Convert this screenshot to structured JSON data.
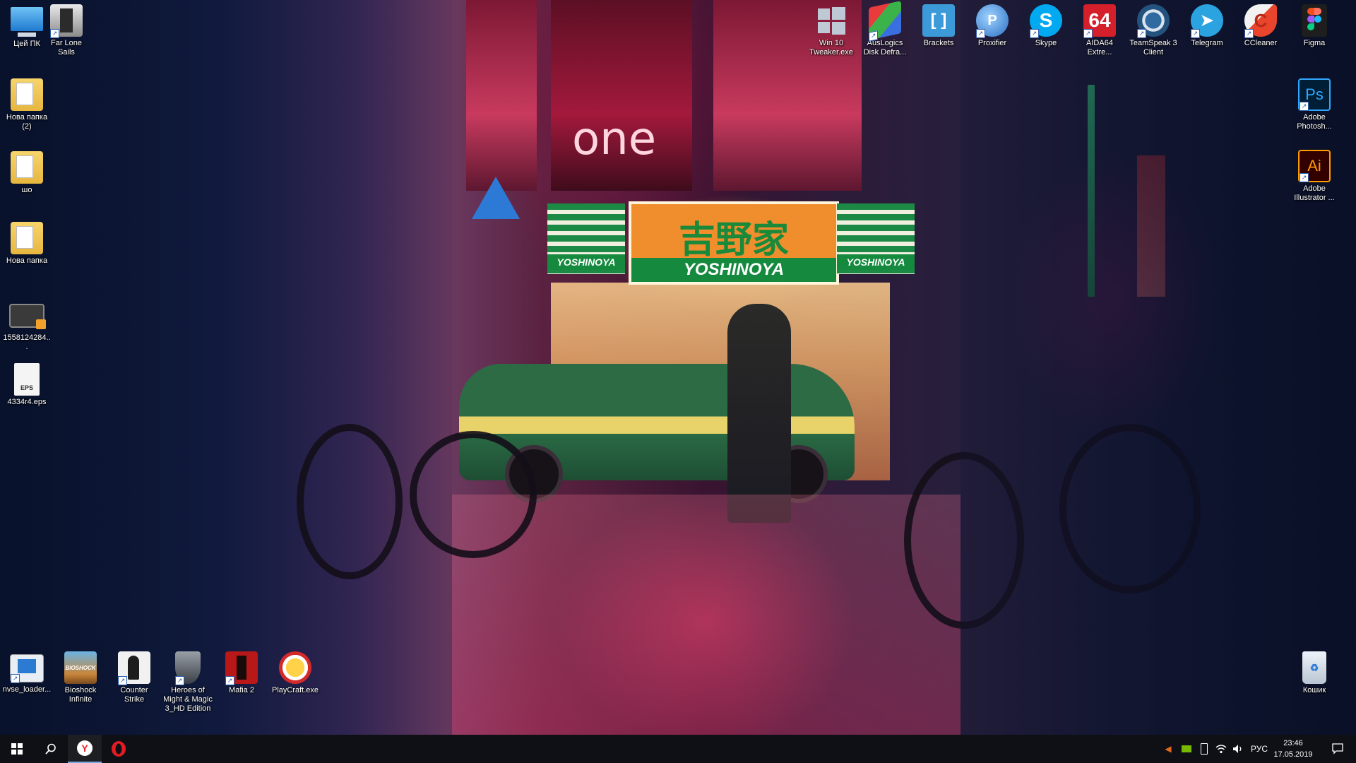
{
  "desktop": {
    "left_column": [
      {
        "label": "Цей ПК",
        "icon": "computer-icon"
      },
      {
        "label": "Нова папка (2)",
        "icon": "folder-icon"
      },
      {
        "label": "шо",
        "icon": "folder-icon"
      },
      {
        "label": "Нова папка",
        "icon": "folder-icon"
      },
      {
        "label": "1558124284...",
        "icon": "video-file-icon"
      },
      {
        "label": "4334r4.eps",
        "icon": "eps-file-icon"
      }
    ],
    "far_lone_sails": {
      "label": "Far Lone Sails",
      "icon": "game-icon"
    },
    "top_row": [
      {
        "label": "Win 10 Tweaker.exe",
        "icon": "windows-icon",
        "glyph": "⊞"
      },
      {
        "label": "AusLogics Disk Defra...",
        "icon": "defrag-icon",
        "glyph": "▦"
      },
      {
        "label": "Brackets",
        "icon": "brackets-icon",
        "glyph": "[ ]"
      },
      {
        "label": "Proxifier",
        "icon": "proxifier-icon",
        "glyph": "P"
      },
      {
        "label": "Skype",
        "icon": "skype-icon",
        "glyph": "S"
      },
      {
        "label": "AIDA64 Extre...",
        "icon": "aida64-icon",
        "glyph": "64"
      },
      {
        "label": "TeamSpeak 3 Client",
        "icon": "teamspeak-icon",
        "glyph": "◉"
      },
      {
        "label": "Telegram",
        "icon": "telegram-icon",
        "glyph": "➤"
      },
      {
        "label": "CCleaner",
        "icon": "ccleaner-icon",
        "glyph": "C"
      },
      {
        "label": "Figma",
        "icon": "figma-icon",
        "glyph": "✦"
      }
    ],
    "right_column": [
      {
        "label": "Adobe Photosh...",
        "icon": "photoshop-icon",
        "glyph": "Ps"
      },
      {
        "label": "Adobe Illustrator ...",
        "icon": "illustrator-icon",
        "glyph": "Ai"
      }
    ],
    "bottom_row": [
      {
        "label": "nvse_loader...",
        "icon": "nvse-icon"
      },
      {
        "label": "Bioshock Infinite",
        "icon": "bioshock-icon"
      },
      {
        "label": "Counter Strike",
        "icon": "counter-strike-icon"
      },
      {
        "label": "Heroes of Might & Magic 3_HD Edition",
        "icon": "heroes-icon"
      },
      {
        "label": "Mafia 2",
        "icon": "mafia-icon"
      },
      {
        "label": "PlayCraft.exe",
        "icon": "playcraft-icon"
      }
    ],
    "recycle_bin": {
      "label": "Кошик",
      "icon": "recycle-bin-icon"
    },
    "wallpaper": {
      "sign_kanji": "吉野家",
      "sign_brand": "YOSHINOYA",
      "poster_text": "one"
    }
  },
  "taskbar": {
    "start": {
      "icon": "windows-start-icon"
    },
    "search": {
      "icon": "search-icon"
    },
    "pinned": [
      {
        "name": "Yandex Browser",
        "icon": "yandex-icon",
        "active": true
      },
      {
        "name": "Opera",
        "icon": "opera-icon",
        "active": false
      }
    ],
    "tray": {
      "language": "РУС",
      "time": "23:46",
      "date": "17.05.2019"
    }
  },
  "colors": {
    "taskbar_bg": "#101014",
    "accent": "#7aa7e0",
    "photoshop": "#31a8ff",
    "illustrator": "#ff9a00"
  }
}
